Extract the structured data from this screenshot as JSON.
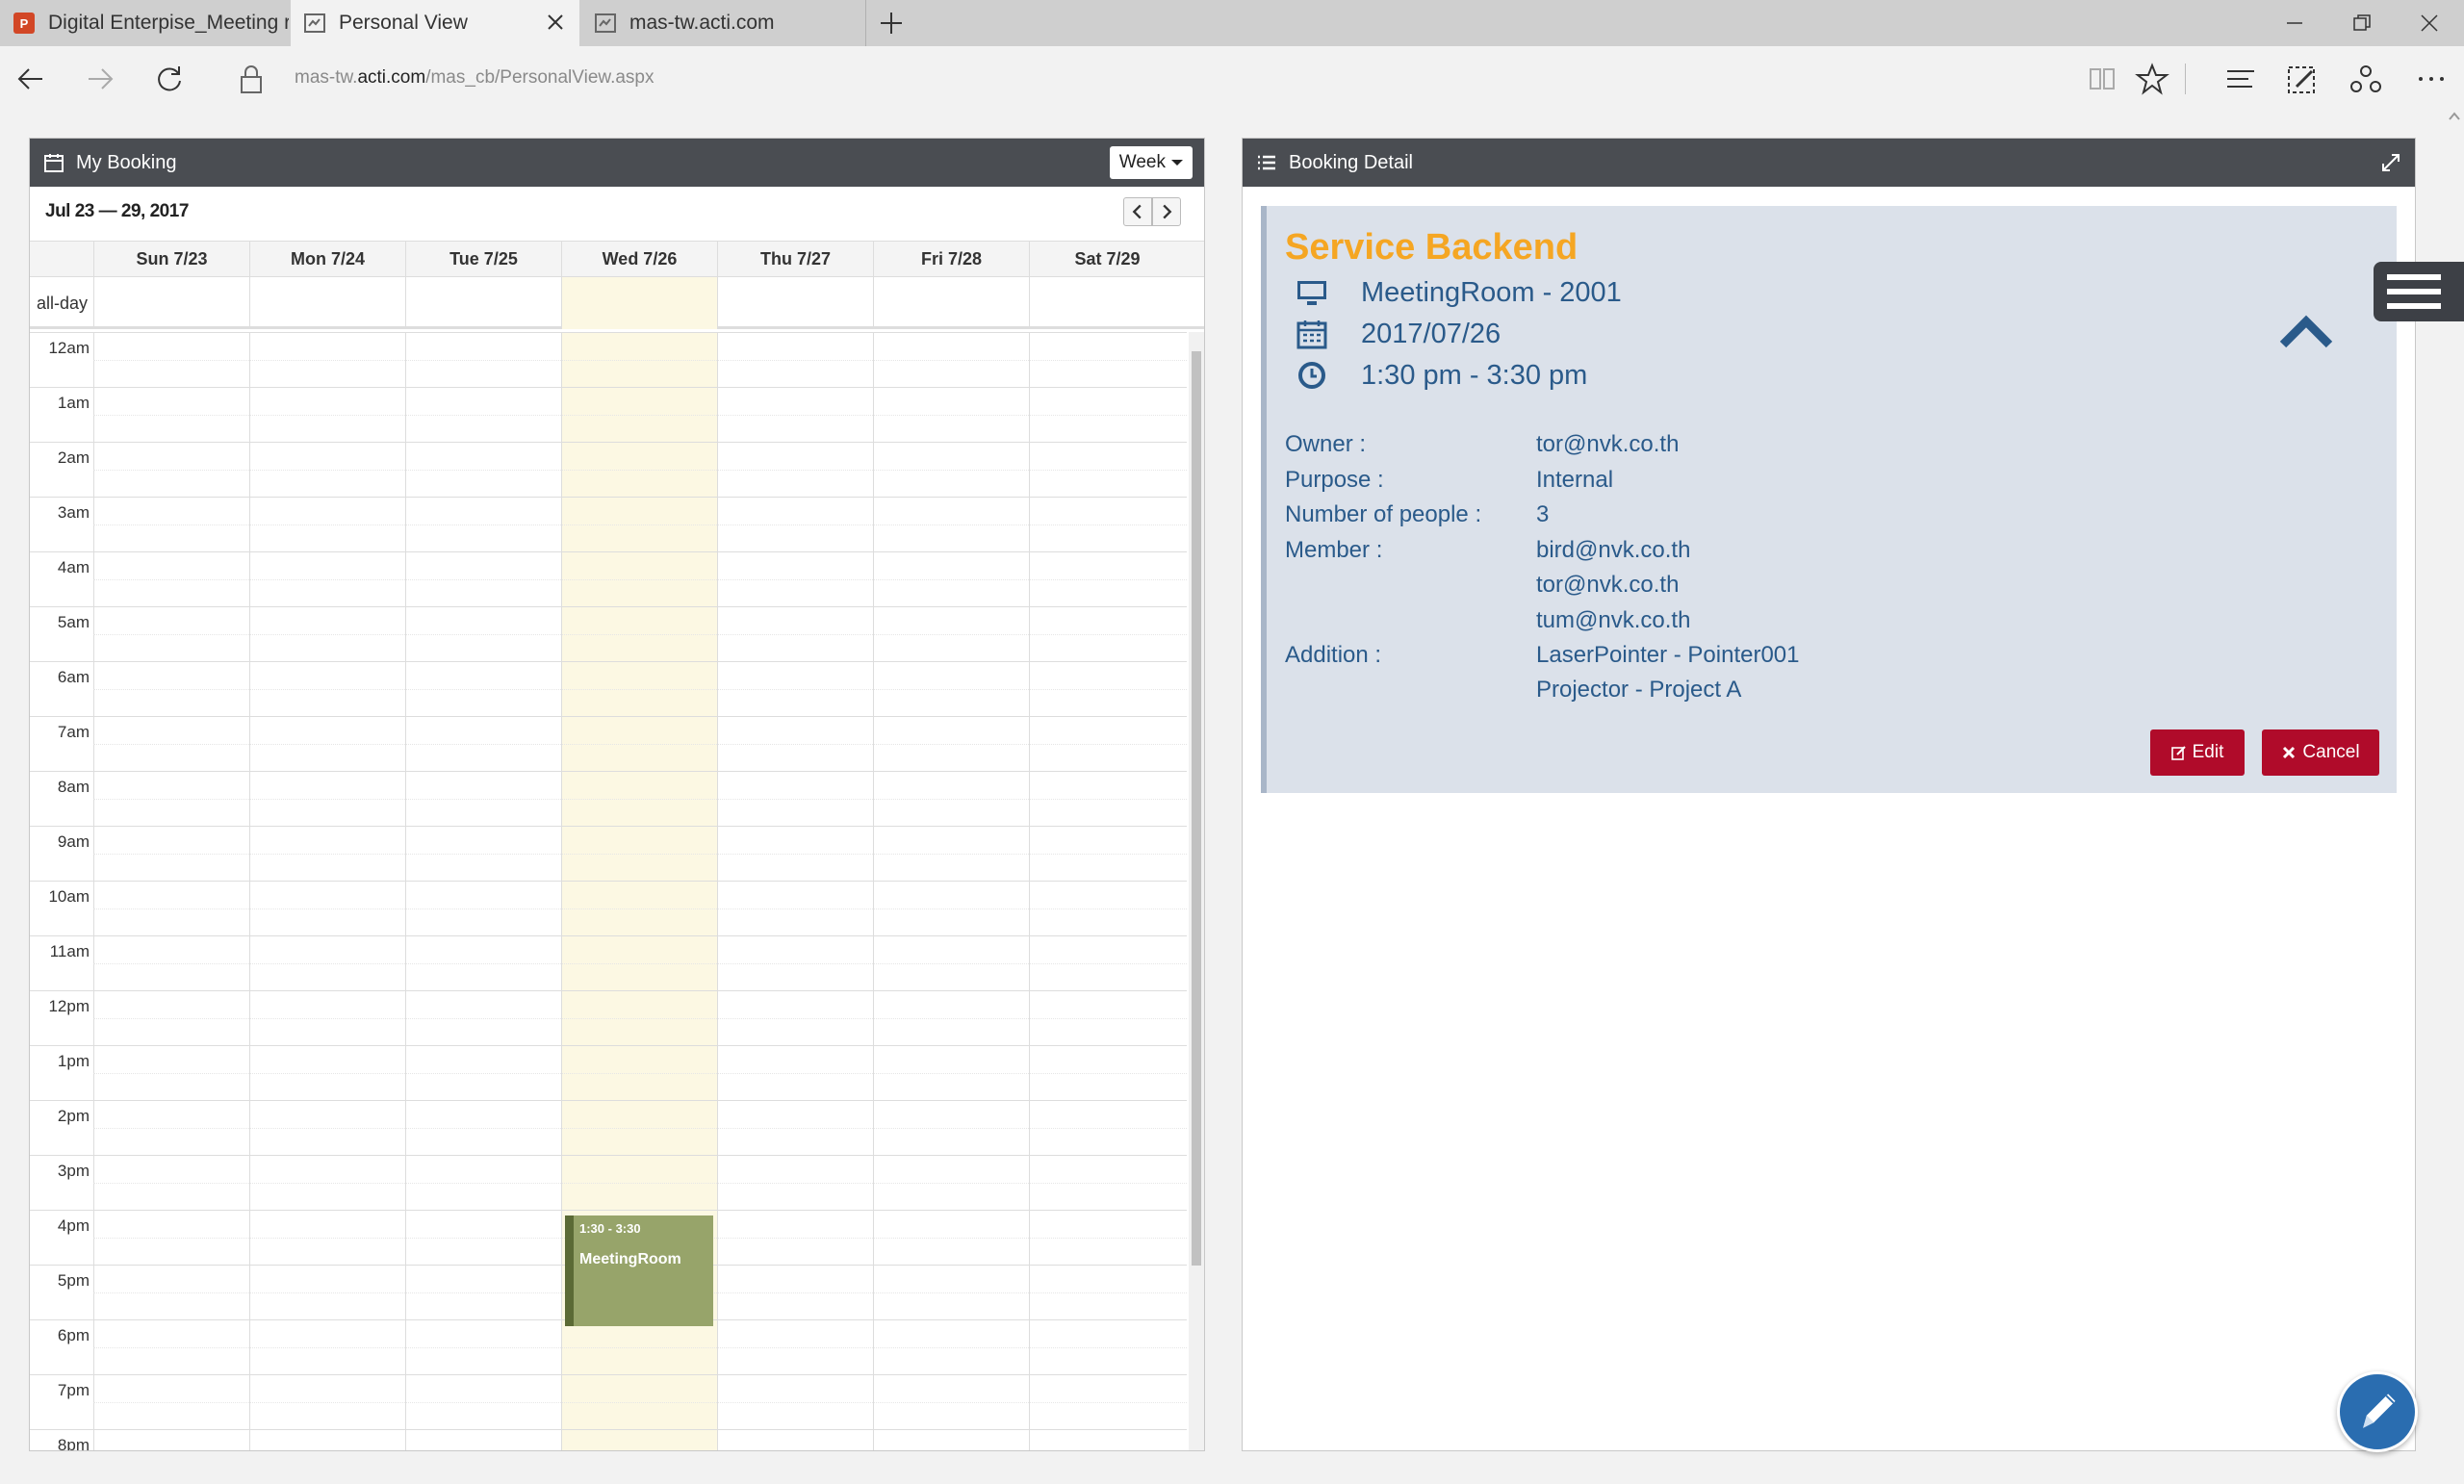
{
  "browser": {
    "tabs": [
      {
        "label": "Digital Enterpise_Meeting re",
        "active": false,
        "icon": "powerpoint-icon"
      },
      {
        "label": "Personal View",
        "active": true,
        "icon": "page-icon"
      },
      {
        "label": "mas-tw.acti.com",
        "active": false,
        "icon": "page-icon"
      }
    ],
    "url_prefix": "mas-tw.",
    "url_domain": "acti.com",
    "url_path": "/mas_cb/PersonalView.aspx"
  },
  "booking": {
    "title": "My Booking",
    "view_label": "Week",
    "range": "Jul 23 — 29, 2017",
    "allday_label": "all-day",
    "days": [
      "Sun 7/23",
      "Mon 7/24",
      "Tue 7/25",
      "Wed 7/26",
      "Thu 7/27",
      "Fri 7/28",
      "Sat 7/29"
    ],
    "today_index": 3,
    "hours": [
      "12am",
      "1am",
      "2am",
      "3am",
      "4am",
      "5am",
      "6am",
      "7am",
      "8am",
      "9am",
      "10am",
      "11am",
      "12pm",
      "1pm",
      "2pm",
      "3pm",
      "4pm",
      "5pm",
      "6pm",
      "7pm",
      "8pm"
    ],
    "event": {
      "time": "1:30 - 3:30",
      "title": "MeetingRoom",
      "color": "#97a46a"
    }
  },
  "detail": {
    "title": "Booking Detail",
    "service": "Service Backend",
    "room": "MeetingRoom - 2001",
    "date": "2017/07/26",
    "time": "1:30 pm - 3:30 pm",
    "owner_label": "Owner :",
    "owner": "tor@nvk.co.th",
    "purpose_label": "Purpose :",
    "purpose": "Internal",
    "people_label": "Number of people :",
    "people": "3",
    "member_label": "Member :",
    "members": [
      "bird@nvk.co.th",
      "tor@nvk.co.th",
      "tum@nvk.co.th"
    ],
    "addition_label": "Addition :",
    "additions": [
      "LaserPointer - Pointer001",
      "Projector - Project A"
    ],
    "edit_label": "Edit",
    "cancel_label": "Cancel",
    "accent_color": "#f5a623",
    "button_color": "#b00b2a"
  }
}
